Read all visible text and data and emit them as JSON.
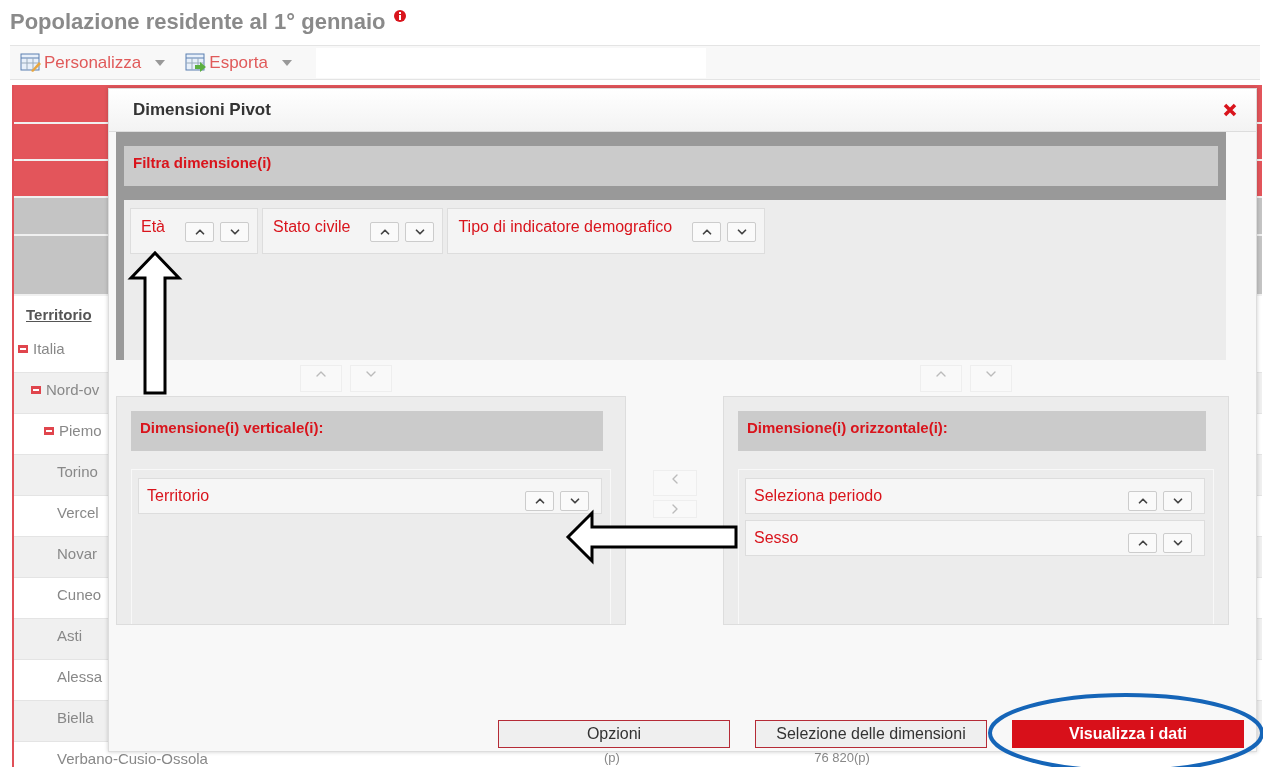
{
  "page": {
    "title": "Popolazione residente al 1° gennaio"
  },
  "toolbar": [
    {
      "label": "Personalizza",
      "kind": "edit"
    },
    {
      "label": "Esporta",
      "kind": "export"
    }
  ],
  "table": {
    "column_header": "Territorio",
    "rows": [
      {
        "label": "Italia",
        "expanded": true,
        "children": [
          {
            "label": "Nord-ov",
            "expanded": true,
            "children": [
              {
                "label": "Piemo",
                "expanded": true,
                "children": [
                  {
                    "label": "Torino"
                  },
                  {
                    "label": "Vercel"
                  },
                  {
                    "label": "Novar"
                  },
                  {
                    "label": "Cuneo"
                  },
                  {
                    "label": "Asti"
                  },
                  {
                    "label": "Alessa"
                  },
                  {
                    "label": "Biella"
                  },
                  {
                    "label": "Verbano-Cusio-Ossola"
                  }
                ]
              }
            ]
          }
        ]
      }
    ],
    "last_row_cells": [
      "(p)",
      "76 820",
      "(p)"
    ]
  },
  "dialog": {
    "title": "Dimensioni Pivot",
    "filter": {
      "heading": "Filtra dimensione(i)",
      "items": [
        "Età",
        "Stato civile",
        "Tipo di indicatore demografico"
      ]
    },
    "vertical": {
      "heading": "Dimensione(i) verticale(i):",
      "items": [
        "Territorio"
      ]
    },
    "horizontal": {
      "heading": "Dimensione(i) orizzontale(i):",
      "items": [
        "Seleziona periodo",
        "Sesso"
      ]
    },
    "buttons": [
      {
        "label": "Opzioni",
        "kind": "secondary"
      },
      {
        "label": "Selezione delle dimensioni",
        "kind": "secondary"
      },
      {
        "label": "Visualizza i dati",
        "kind": "primary"
      }
    ]
  }
}
